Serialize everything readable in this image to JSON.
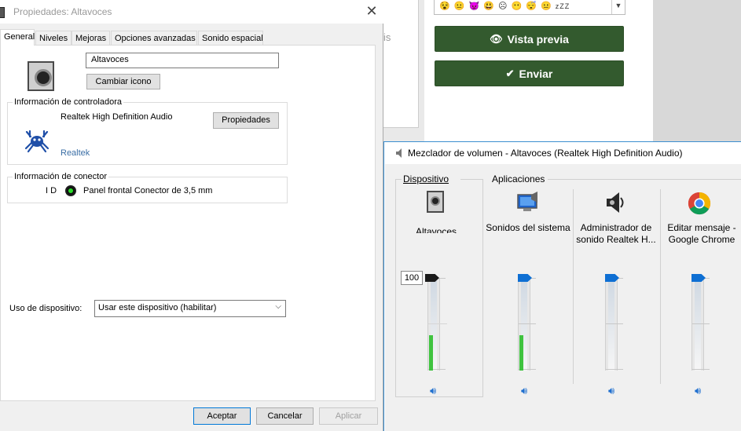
{
  "web_page": {
    "partial_char": "is",
    "emoji_strip": "😵 😐 👿 😃 ☹ 😶 😴 😐",
    "emoji_zz": "zZZ",
    "preview_button": "Vista previa",
    "send_button": "Enviar"
  },
  "properties": {
    "title": "Propiedades: Altavoces",
    "tabs": [
      "General",
      "Niveles",
      "Mejoras",
      "Opciones avanzadas",
      "Sonido espacial"
    ],
    "active_tab": 0,
    "device_name": "Altavoces",
    "change_icon_button": "Cambiar icono",
    "controller_group": "Información de controladora",
    "controller_name": "Realtek High Definition Audio",
    "controller_properties_button": "Propiedades",
    "manufacturer": "Realtek",
    "connector_group": "Información de conector",
    "connector_id_label": "I D",
    "connector_desc": "Panel frontal Conector de 3,5 mm",
    "usage_label": "Uso de dispositivo:",
    "usage_value": "Usar este dispositivo (habilitar)",
    "buttons": {
      "ok": "Aceptar",
      "cancel": "Cancelar",
      "apply": "Aplicar"
    },
    "colors": {
      "jack": "#2adc2a",
      "primary_border": "#0078d7"
    }
  },
  "mixer": {
    "title": "Mezclador de volumen - Altavoces (Realtek High Definition Audio)",
    "section_device": "Dispositivo",
    "section_apps": "Aplicaciones",
    "device_percent": "100",
    "channels": [
      {
        "label": "Altavoces",
        "icon": "speaker-device-icon",
        "volume": 100,
        "meter": 0.38
      },
      {
        "label": "Sonidos del sistema",
        "icon": "system-sounds-icon",
        "volume": 100,
        "meter": 0.38
      },
      {
        "label": "Administrador de sonido Realtek H...",
        "icon": "realtek-manager-icon",
        "volume": 100,
        "meter": 0
      },
      {
        "label": "Editar mensaje - Google Chrome",
        "icon": "chrome-icon",
        "volume": 100,
        "meter": 0
      }
    ],
    "colors": {
      "thumb": "#0e6fd3",
      "meter": "#3fc33f"
    }
  }
}
